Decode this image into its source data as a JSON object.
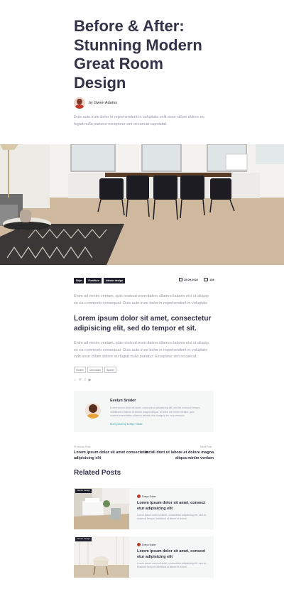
{
  "article": {
    "title": "Before & After: Stunning Modern Great Room Design",
    "author_name": "by Gwen Adams",
    "intro": "Duis aute irure dolor in reprehenderit in voluptate velit esse cillum dolore eu fugiat nulla pariatur excepteur sint occaecat cupidatat.",
    "categories": [
      "Style",
      "Furniture",
      "Interior design"
    ],
    "date": "25.09.2022",
    "comments": "156",
    "paragraph1": "Enim ad minim veniam, quis nostrud exercitation ullamco laboris nisi ut aliquip ex ea commodo consequat. Duis aute irure dolor in reprehenderit in voluptate",
    "subheading": "Lorem ipsum dolor sit amet, consectetur adipisicing elit, sed do tempor et sit.",
    "paragraph2": "Enim ad minim veniam, quis nostrud exercitation ullamco laboris nisi ut aliquip ex ea commodo consequat. Duis aute irure dolor in reprehenderit in voluptate velit esse cillum dolore eu fugiat nulla pariatur. Excepteur sint occaecat.",
    "keywords": [
      "Modern",
      "Decoration",
      "Spaces"
    ]
  },
  "author_box": {
    "name": "Evelyn Snider",
    "bio": "Lorem ipsum dolor sit amet, consectetur adipisicing elit, sed do eiusmod tempor incididunt ut labore et dolore magna aliqua. Ut enim ad minim veniam, quis nostrud exercitation ullamco laboris nisi ut aliquip ex ea commodo.",
    "link": "More posts by Evelyn Snider"
  },
  "post_nav": {
    "prev_label": "Previous Post",
    "prev_title": "Lorem ipsum dolor sit amet consectetur adipisicing elit",
    "next_label": "Next Post",
    "next_title": "Incidi dunt ut labore et dolore magna aliqua minim veniam"
  },
  "related": {
    "heading": "Related Posts",
    "posts": [
      {
        "badge": "Interior design",
        "author": "Evelyn Snider",
        "title": "Lorem ipsum dolor sit amet, consect etur adipisicing elit",
        "excerpt": "Lorem ipsum dolor sit amet, consectetur adipisicing elit, sed do eiusmod tempor incididunt ut labore et dolore."
      },
      {
        "badge": "Interior design",
        "author": "Evelyn Snider",
        "title": "Lorem ipsum dolor sit amet, consect etur adipisicing elit",
        "excerpt": "Lorem ipsum dolor sit amet, consectetur adipisicing elit, sed do eiusmod tempor incididunt ut labore et dolore."
      }
    ]
  },
  "icons": {
    "share": [
      "link-icon",
      "twitter-icon",
      "facebook-icon",
      "youtube-icon"
    ]
  },
  "colors": {
    "accent": "#2aa7a7",
    "dark": "#1f1f2e",
    "heading": "#33334a"
  }
}
